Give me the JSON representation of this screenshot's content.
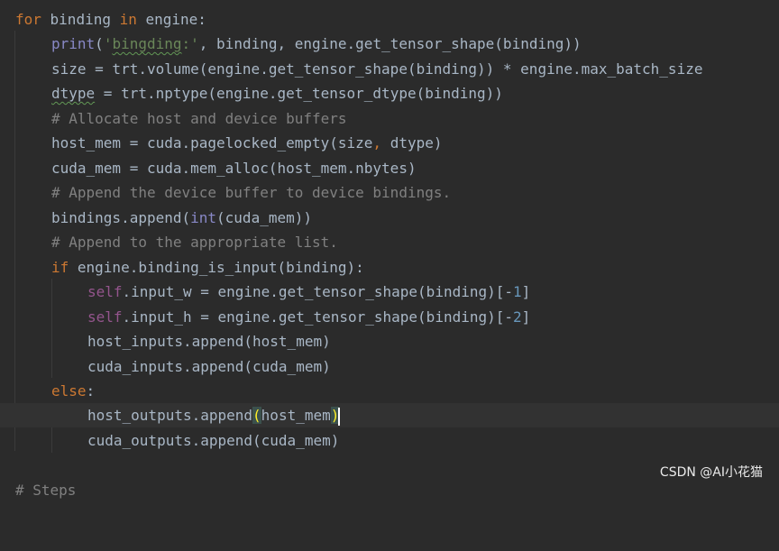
{
  "colors": {
    "background": "#2b2b2b",
    "text": "#a9b7c6",
    "keyword": "#cc7832",
    "string": "#6a8759",
    "comment": "#808080",
    "self": "#94558d",
    "number": "#6897bb",
    "builtin": "#8888c6",
    "current_line": "#323232"
  },
  "code": {
    "l1": {
      "kw_for": "for",
      "a": " binding ",
      "kw_in": "in",
      "b": " engine:"
    },
    "l2": {
      "fn": "print",
      "a": "(",
      "str_open": "'",
      "str_word": "bingding",
      "str_close": ":'",
      "b": ", binding, engine.get_tensor_shape(binding))"
    },
    "l3": {
      "a": "size = trt.volume(engine.get_tensor_shape(binding)) * engine.max_batch_size"
    },
    "l4": {
      "word": "dtype",
      "a": " = trt.nptype(engine.get_tensor_dtype(binding))"
    },
    "l5": {
      "comment": "# Allocate host and device buffers"
    },
    "l6": {
      "a": "host_mem = cuda.pagelocked_empty(size",
      "comma": ",",
      "b": " dtype)"
    },
    "l7": {
      "a": "cuda_mem = cuda.mem_alloc(host_mem.nbytes)"
    },
    "l8": {
      "comment": "# Append the device buffer to device bindings."
    },
    "l9": {
      "a": "bindings.append(",
      "builtin": "int",
      "b": "(cuda_mem))"
    },
    "l10": {
      "comment": "# Append to the appropriate list."
    },
    "l11": {
      "kw_if": "if",
      "a": " engine.binding_is_input(binding):"
    },
    "l12": {
      "self": "self",
      "a": ".input_w = engine.get_tensor_shape(binding)[-",
      "num": "1",
      "b": "]"
    },
    "l13": {
      "self": "self",
      "a": ".input_h = engine.get_tensor_shape(binding)[-",
      "num": "2",
      "b": "]"
    },
    "l14": {
      "a": "host_inputs.append(host_mem)"
    },
    "l15": {
      "a": "cuda_inputs.append(cuda_mem)"
    },
    "l16": {
      "kw_else": "else",
      "a": ":"
    },
    "l17": {
      "a": "host_outputs.append",
      "open": "(",
      "b": "host_mem",
      "close": ")"
    },
    "l18": {
      "a": "cuda_outputs.append(cuda_mem)"
    },
    "l19": {
      "comment": "# Steps"
    }
  },
  "watermark": "CSDN @AI小花猫"
}
